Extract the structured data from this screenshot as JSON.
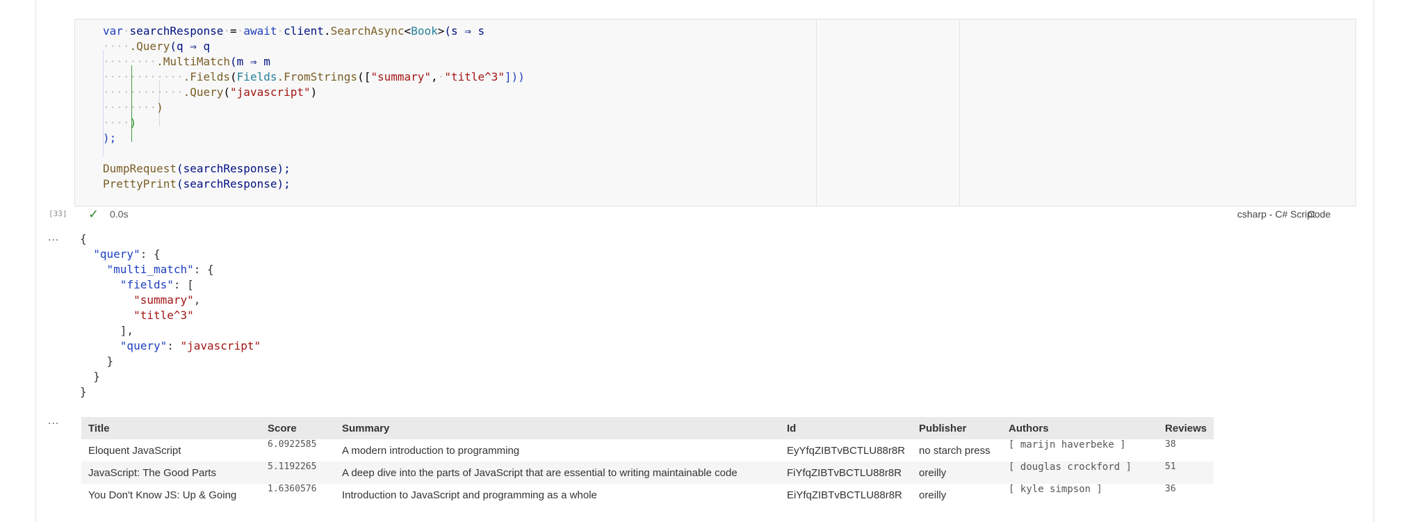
{
  "code": {
    "line1": {
      "kw": "var",
      "v": "searchResponse",
      "eq": "=",
      "aw": "await",
      "obj": "client",
      "dot": ".",
      "fn": "SearchAsync",
      "lt": "<",
      "ty": "Book",
      "gt": ">",
      "rest": "(s ⇒ s"
    },
    "line2": {
      "fn": ".Query",
      "rest": "(q ⇒ q"
    },
    "line3": {
      "fn": ".MultiMatch",
      "rest": "(m ⇒ m"
    },
    "line4": {
      "fn": ".Fields",
      "p1": "(",
      "ty": "Fields",
      "fn2": ".FromStrings",
      "p2": "([",
      "s1": "\"summary\"",
      "comma": ",",
      "s2": "\"title^3\"",
      "p3": "]))"
    },
    "line5": {
      "fn": ".Query",
      "p1": "(",
      "s": "\"javascript\"",
      "p2": ")"
    },
    "line6": ")",
    "line7": ")",
    "line8": ");",
    "line10": {
      "fn": "DumpRequest",
      "rest": "(searchResponse);"
    },
    "line11": {
      "fn": "PrettyPrint",
      "rest": "(searchResponse);"
    }
  },
  "status": {
    "execution_count": "[33]",
    "check_glyph": "✓",
    "duration": "0.0s",
    "language": "csharp - C# Script",
    "cell_kind": "Code"
  },
  "output_ellipsis": "...",
  "json_output": {
    "open": "{",
    "query_key": "\"query\"",
    "multi_match_key": "\"multi_match\"",
    "fields_key": "\"fields\"",
    "field1": "\"summary\"",
    "field2": "\"title^3\"",
    "query_inner_key": "\"query\"",
    "query_value": "\"javascript\"",
    "close": "}"
  },
  "table": {
    "headers": [
      "Title",
      "Score",
      "Summary",
      "Id",
      "Publisher",
      "Authors",
      "Reviews"
    ],
    "rows": [
      {
        "title": "Eloquent JavaScript",
        "score": "6.0922585",
        "summary": "A modern introduction to programming",
        "id": "EyYfqZIBTvBCTLU88r8R",
        "publisher": "no starch press",
        "authors": "[ marijn haverbeke ]",
        "reviews": "38"
      },
      {
        "title": "JavaScript: The Good Parts",
        "score": "5.1192265",
        "summary": "A deep dive into the parts of JavaScript that are essential to writing maintainable code",
        "id": "FiYfqZIBTvBCTLU88r8R",
        "publisher": "oreilly",
        "authors": "[ douglas crockford ]",
        "reviews": "51"
      },
      {
        "title": "You Don't Know JS: Up & Going",
        "score": "1.6360576",
        "summary": "Introduction to JavaScript and programming as a whole",
        "id": "EiYfqZIBTvBCTLU88r8R",
        "publisher": "oreilly",
        "authors": "[ kyle simpson ]",
        "reviews": "36"
      }
    ]
  },
  "colors": {
    "keyword": "#1d3fbf",
    "type": "#267f99",
    "function": "#795e26",
    "string": "#a31515",
    "check": "#388a34"
  }
}
